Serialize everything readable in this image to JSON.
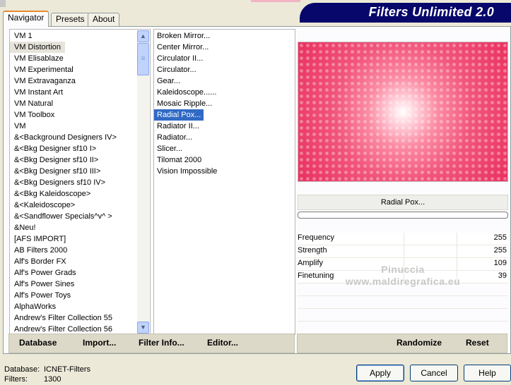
{
  "tabs": [
    {
      "label": "Navigator",
      "active": true
    },
    {
      "label": "Presets",
      "active": false
    },
    {
      "label": "About",
      "active": false
    }
  ],
  "logo": {
    "text": "Filters Unlimited 2.0"
  },
  "categories": {
    "items": [
      "VM 1",
      "VM Distortion",
      "VM Elisablaze",
      "VM Experimental",
      "VM Extravaganza",
      "VM Instant Art",
      "VM Natural",
      "VM Toolbox",
      "VM",
      "&<Background Designers IV>",
      "&<Bkg Designer sf10 I>",
      "&<Bkg Designer sf10 II>",
      "&<Bkg Designer sf10 III>",
      "&<Bkg Designers sf10 IV>",
      "&<Bkg Kaleidoscope>",
      "&<Kaleidoscope>",
      "&<Sandflower Specials^v^ >",
      "&Neu!",
      "[AFS IMPORT]",
      "AB Filters 2000",
      "Alf's Border FX",
      "Alf's Power Grads",
      "Alf's Power Sines",
      "Alf's Power Toys",
      "AlphaWorks",
      "Andrew's Filter Collection 55",
      "Andrew's Filter Collection 56"
    ],
    "selected": "VM Distortion"
  },
  "filters": {
    "items": [
      "Broken Mirror...",
      "Center Mirror...",
      "Circulator II...",
      "Circulator...",
      "Gear...",
      "Kaleidoscope......",
      "Mosaic Ripple...",
      "Radial Pox...",
      "Radiator II...",
      "Radiator...",
      "Slicer...",
      "Tilomat 2000",
      "Vision Impossible"
    ],
    "selected": "Radial Pox..."
  },
  "preview": {
    "filter_name": "Radial Pox...",
    "colors": [
      "#ffffff",
      "#fb8ba3",
      "#e9305f"
    ]
  },
  "params": [
    {
      "label": "Frequency",
      "value": "255"
    },
    {
      "label": "Strength",
      "value": "255"
    },
    {
      "label": "Amplify",
      "value": "109"
    },
    {
      "label": "Finetuning",
      "value": "39"
    }
  ],
  "watermark": {
    "line1": "Pinuccia",
    "line2": "www.maldiregrafica.eu"
  },
  "toolbar": {
    "database": "Database",
    "import": "Import...",
    "filter_info": "Filter Info...",
    "editor": "Editor...",
    "randomize": "Randomize",
    "reset": "Reset"
  },
  "footer": {
    "database_label": "Database:",
    "database_value": "ICNET-Filters",
    "filters_label": "Filters:",
    "filters_value": "1300"
  },
  "buttons": {
    "apply": "Apply",
    "cancel": "Cancel",
    "help": "Help"
  }
}
